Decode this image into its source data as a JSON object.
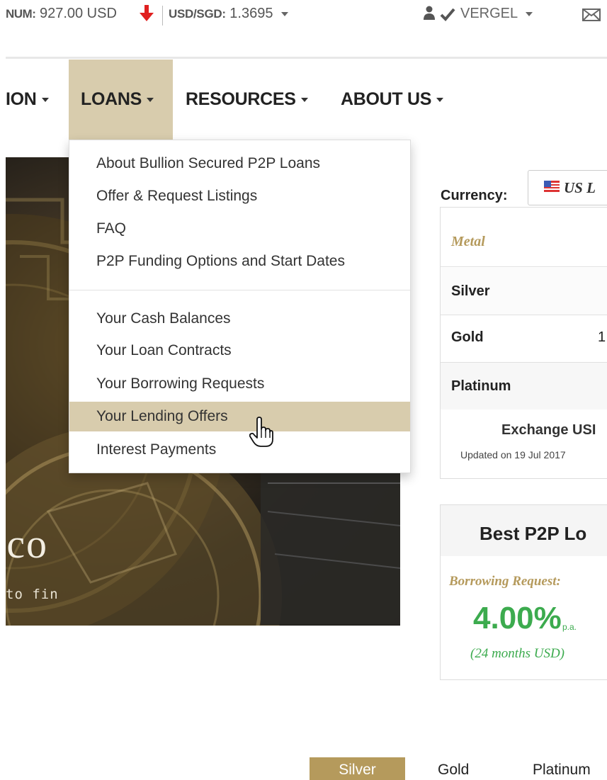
{
  "ticker": {
    "metal_label": "NUM:",
    "metal_price": "927.00 USD",
    "trend": "down",
    "fx_label": "USD/SGD:",
    "fx_value": "1.3695"
  },
  "user": {
    "name": "VERGEL",
    "status": "verified"
  },
  "nav": {
    "items": [
      {
        "label": "ION"
      },
      {
        "label": "LOANS"
      },
      {
        "label": "RESOURCES"
      },
      {
        "label": "ABOUT US"
      }
    ],
    "active": "LOANS"
  },
  "loans_menu": {
    "section1": [
      "About Bullion Secured P2P Loans",
      "Offer & Request Listings",
      "FAQ",
      "P2P Funding Options and Start Dates"
    ],
    "section2": [
      "Your Cash Balances",
      "Your Loan Contracts",
      "Your Borrowing Requests",
      "Your Lending Offers",
      "Interest Payments"
    ],
    "hovered": "Your Lending Offers"
  },
  "hero": {
    "title": "rco",
    "subtitle": "to fin"
  },
  "prices": {
    "currency_label": "Currency:",
    "currency_value": "US L",
    "metal_header": "Metal",
    "rows": [
      {
        "name": "Silver",
        "value": ""
      },
      {
        "name": "Gold",
        "value": "1"
      },
      {
        "name": "Platinum",
        "value": ""
      }
    ],
    "exchange_title": "Exchange USI",
    "updated": "Updated on 19 Jul 2017"
  },
  "best_p2p": {
    "title": "Best P2P Lo",
    "label": "Borrowing Request:",
    "rate": "4.00%",
    "rate_unit": "p.a.",
    "term": "(24 months USD)"
  },
  "bottom_tabs": {
    "items": [
      "Silver",
      "Gold",
      "Platinum"
    ],
    "active": "Silver"
  },
  "colors": {
    "accent_gold": "#b59a5c",
    "nav_highlight": "#d8ccad",
    "rate_green": "#3cab4e",
    "trend_red": "#e02020"
  }
}
